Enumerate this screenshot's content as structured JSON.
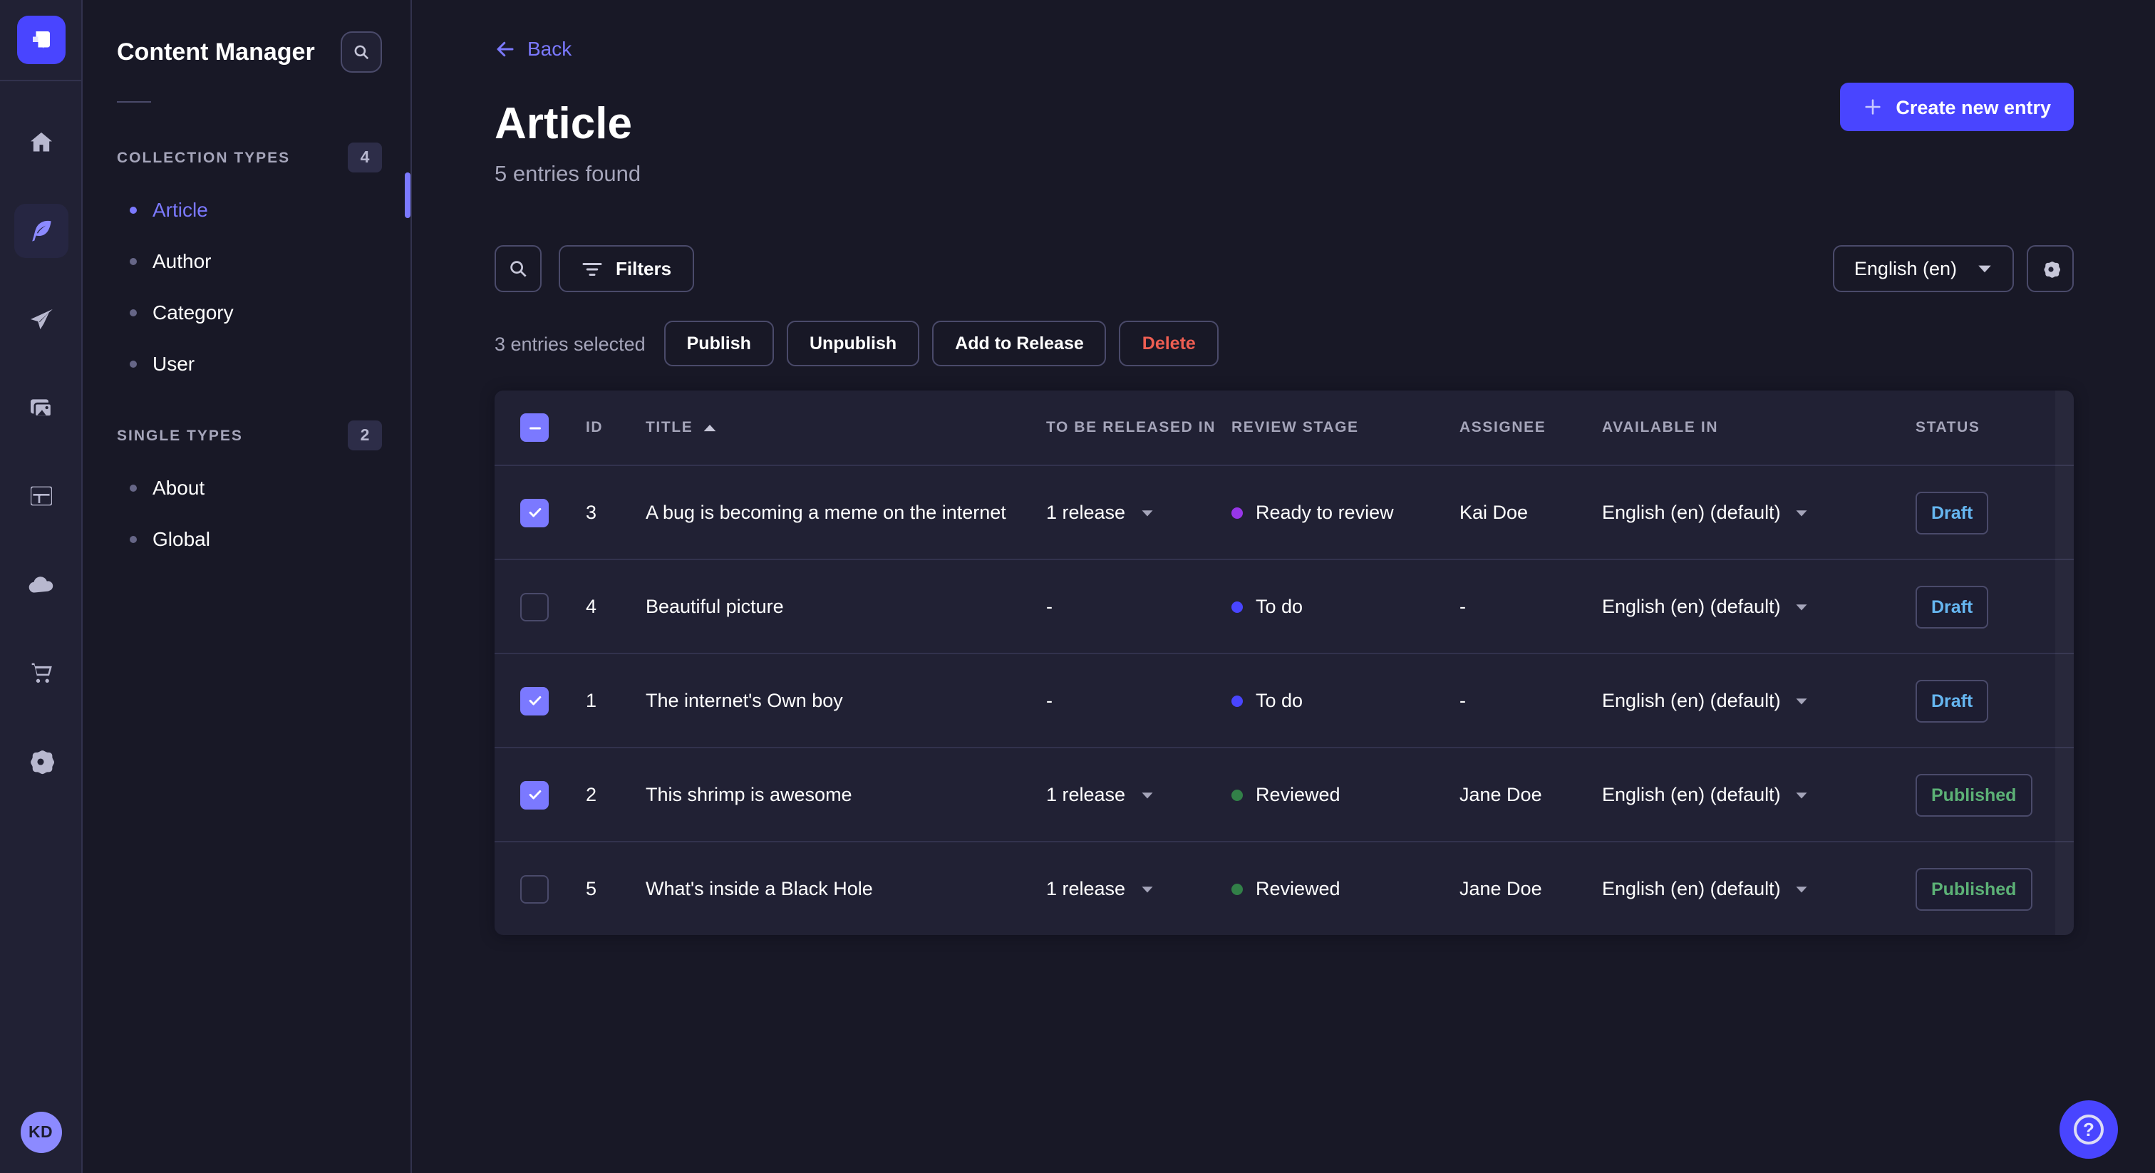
{
  "colors": {
    "primary": "#4945ff",
    "primary_light": "#7b79ff",
    "app_bg": "#181826",
    "card_bg": "#212134",
    "border": "#32324d",
    "muted_text": "#a5a5ba",
    "danger": "#ee5e52",
    "draft": "#66b7f1",
    "published": "#5cb176"
  },
  "nav": {
    "logo": "strapi-logo",
    "items": [
      {
        "icon": "home-icon",
        "label": "Home",
        "active": false
      },
      {
        "icon": "feather-icon",
        "label": "Content Manager",
        "active": true
      },
      {
        "icon": "paper-plane-icon",
        "label": "Releases",
        "active": false
      },
      {
        "icon": "media-library-icon",
        "label": "Media Library",
        "active": false
      },
      {
        "icon": "layout-icon",
        "label": "Content-Type Builder",
        "active": false
      },
      {
        "icon": "cloud-icon",
        "label": "Deploy",
        "active": false
      },
      {
        "icon": "cart-icon",
        "label": "Marketplace",
        "active": false
      },
      {
        "icon": "gear-icon",
        "label": "Settings",
        "active": false
      }
    ],
    "avatar_initials": "KD"
  },
  "subnav": {
    "title": "Content Manager",
    "sections": [
      {
        "label": "COLLECTION TYPES",
        "count": "4",
        "items": [
          {
            "label": "Article",
            "active": true
          },
          {
            "label": "Author",
            "active": false
          },
          {
            "label": "Category",
            "active": false
          },
          {
            "label": "User",
            "active": false
          }
        ]
      },
      {
        "label": "SINGLE TYPES",
        "count": "2",
        "items": [
          {
            "label": "About",
            "active": false
          },
          {
            "label": "Global",
            "active": false
          }
        ]
      }
    ]
  },
  "header": {
    "back_label": "Back",
    "title": "Article",
    "subtitle": "5 entries found",
    "create_label": "Create new entry"
  },
  "toolbar": {
    "filters_label": "Filters",
    "locale_value": "English (en)"
  },
  "selection": {
    "text": "3 entries selected",
    "publish_label": "Publish",
    "unpublish_label": "Unpublish",
    "add_to_release_label": "Add to Release",
    "delete_label": "Delete"
  },
  "table": {
    "headers": {
      "id": "ID",
      "title": "TITLE",
      "released_in": "TO BE RELEASED IN",
      "review_stage": "REVIEW STAGE",
      "assignee": "ASSIGNEE",
      "available_in": "AVAILABLE IN",
      "status": "STATUS"
    },
    "sort": {
      "column": "TITLE",
      "direction": "asc"
    },
    "rows": [
      {
        "selected": true,
        "id": "3",
        "title": "A bug is becoming a meme on the internet",
        "released_in": "1 release",
        "has_release": true,
        "review": {
          "label": "Ready to review",
          "color": "#9736e8"
        },
        "assignee": "Kai Doe",
        "available_in": "English (en) (default)",
        "status": {
          "label": "Draft",
          "color": "#66b7f1"
        }
      },
      {
        "selected": false,
        "id": "4",
        "title": "Beautiful picture",
        "released_in": "-",
        "has_release": false,
        "review": {
          "label": "To do",
          "color": "#4945ff"
        },
        "assignee": "-",
        "available_in": "English (en) (default)",
        "status": {
          "label": "Draft",
          "color": "#66b7f1"
        }
      },
      {
        "selected": true,
        "id": "1",
        "title": "The internet's Own boy",
        "released_in": "-",
        "has_release": false,
        "review": {
          "label": "To do",
          "color": "#4945ff"
        },
        "assignee": "-",
        "available_in": "English (en) (default)",
        "status": {
          "label": "Draft",
          "color": "#66b7f1"
        }
      },
      {
        "selected": true,
        "id": "2",
        "title": "This shrimp is awesome",
        "released_in": "1 release",
        "has_release": true,
        "review": {
          "label": "Reviewed",
          "color": "#328048"
        },
        "assignee": "Jane Doe",
        "available_in": "English (en) (default)",
        "status": {
          "label": "Published",
          "color": "#5cb176"
        }
      },
      {
        "selected": false,
        "id": "5",
        "title": "What's inside a Black Hole",
        "released_in": "1 release",
        "has_release": true,
        "review": {
          "label": "Reviewed",
          "color": "#328048"
        },
        "assignee": "Jane Doe",
        "available_in": "English (en) (default)",
        "status": {
          "label": "Published",
          "color": "#5cb176"
        }
      }
    ]
  },
  "help": {
    "icon_label": "?"
  }
}
